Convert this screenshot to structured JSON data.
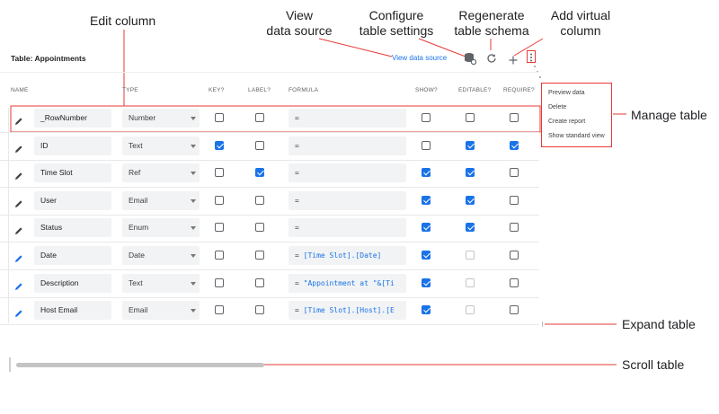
{
  "annotations": {
    "edit_column": "Edit column",
    "view_data_source_1": "View",
    "view_data_source_2": "data source",
    "configure_1": "Configure",
    "configure_2": "table settings",
    "regenerate_1": "Regenerate",
    "regenerate_2": "table schema",
    "add_virtual_1": "Add virtual",
    "add_virtual_2": "column",
    "manage_table": "Manage table",
    "expand_table": "Expand table",
    "scroll_table": "Scroll table"
  },
  "toolbar": {
    "table_title": "Table: Appointments",
    "view_data_source_link": "View data source",
    "icons": [
      "database-settings-icon",
      "refresh-icon",
      "plus-icon",
      "more-vert-icon"
    ]
  },
  "columns": {
    "name": "NAME",
    "type": "TYPE",
    "key": "KEY?",
    "label": "LABEL?",
    "formula": "FORMULA",
    "show": "SHOW?",
    "editable": "EDITABLE?",
    "require": "REQUIRE?"
  },
  "rows": [
    {
      "name": "_RowNumber",
      "type": "Number",
      "formula_prefix": "=",
      "formula_expr": "",
      "key": false,
      "label": false,
      "show": false,
      "editable": false,
      "editable_disabled": false,
      "require": false,
      "virtual": false
    },
    {
      "name": "ID",
      "type": "Text",
      "formula_prefix": "=",
      "formula_expr": "",
      "key": true,
      "label": false,
      "show": false,
      "editable": true,
      "editable_disabled": false,
      "require": true,
      "virtual": false
    },
    {
      "name": "Time Slot",
      "type": "Ref",
      "formula_prefix": "=",
      "formula_expr": "",
      "key": false,
      "label": true,
      "show": true,
      "editable": true,
      "editable_disabled": false,
      "require": false,
      "virtual": false
    },
    {
      "name": "User",
      "type": "Email",
      "formula_prefix": "=",
      "formula_expr": "",
      "key": false,
      "label": false,
      "show": true,
      "editable": true,
      "editable_disabled": false,
      "require": false,
      "virtual": false
    },
    {
      "name": "Status",
      "type": "Enum",
      "formula_prefix": "=",
      "formula_expr": "",
      "key": false,
      "label": false,
      "show": true,
      "editable": true,
      "editable_disabled": false,
      "require": false,
      "virtual": false
    },
    {
      "name": "Date",
      "type": "Date",
      "formula_prefix": "=",
      "formula_expr": "[Time Slot].[Date]",
      "key": false,
      "label": false,
      "show": true,
      "editable": false,
      "editable_disabled": true,
      "require": false,
      "virtual": true
    },
    {
      "name": "Description",
      "type": "Text",
      "formula_prefix": "=",
      "formula_expr": "\"Appointment at \"&[Ti",
      "key": false,
      "label": false,
      "show": true,
      "editable": false,
      "editable_disabled": true,
      "require": false,
      "virtual": true
    },
    {
      "name": "Host Email",
      "type": "Email",
      "formula_prefix": "=",
      "formula_expr": "[Time Slot].[Host].[E",
      "key": false,
      "label": false,
      "show": true,
      "editable": false,
      "editable_disabled": true,
      "require": false,
      "virtual": true
    }
  ],
  "menu": {
    "items": [
      "Preview data",
      "Delete",
      "Create report",
      "Show standard view"
    ]
  },
  "colors": {
    "accent": "#1a73e8",
    "annotation_red": "#e53935"
  }
}
